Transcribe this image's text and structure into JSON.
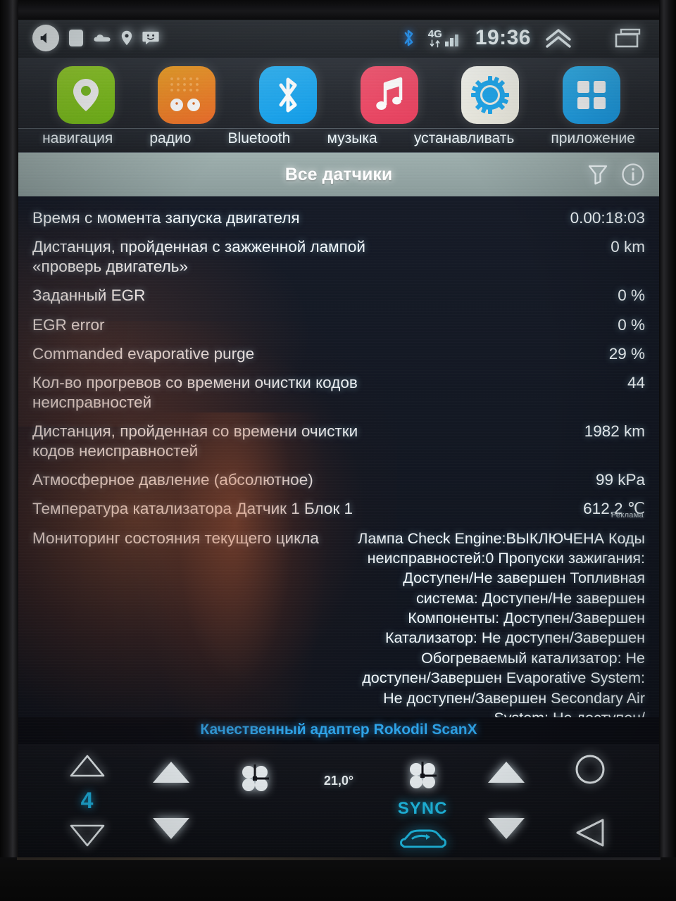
{
  "statusbar": {
    "left_icons": [
      "volume-icon",
      "sim-card-icon",
      "cloud-icon",
      "location-pin-icon",
      "message-icon"
    ],
    "bluetooth_icon": "bluetooth-icon",
    "network_label": "4G",
    "signal_icon": "signal-bars-icon",
    "time": "19:36",
    "expand_icon": "chevron-up-icon",
    "recents_icon": "recent-apps-icon"
  },
  "launcher": {
    "apps": [
      {
        "label": "навигация",
        "icon": "location-pin-icon"
      },
      {
        "label": "радио",
        "icon": "radio-icon"
      },
      {
        "label": "Bluetooth",
        "icon": "bluetooth-icon"
      },
      {
        "label": "музыка",
        "icon": "music-note-icon"
      },
      {
        "label": "устанавливать",
        "icon": "gear-icon"
      },
      {
        "label": "приложение",
        "icon": "grid-apps-icon"
      }
    ]
  },
  "obd": {
    "title": "Все датчики",
    "filter_icon": "filter-icon",
    "info_icon": "info-icon",
    "rows": [
      {
        "name": "Время с момента запуска двигателя",
        "value": "0.00:18:03"
      },
      {
        "name": "Дистанция, пройденная с зажженной лампой «проверь двигатель»",
        "value": "0 km"
      },
      {
        "name": "Заданный EGR",
        "value": "0 %"
      },
      {
        "name": "EGR error",
        "value": "0 %"
      },
      {
        "name": "Commanded evaporative purge",
        "value": "29 %"
      },
      {
        "name": "Кол-во прогревов со времени очистки кодов неисправностей",
        "value": "44"
      },
      {
        "name": "Дистанция, пройденная со времени очистки кодов неисправностей",
        "value": "1982 km"
      },
      {
        "name": "Атмосферное давление (абсолютное)",
        "value": "99 kPa"
      },
      {
        "name": "Температура катализатора Датчик 1 Блок 1",
        "value": "612.2 ℃"
      },
      {
        "name": "Мониторинг состояния текущего цикла",
        "value": "Лампа Check Engine:ВЫКЛЮЧЕНА Коды неисправностей:0 Пропуски зажигания: Доступен/Не завершен Топливная система: Доступен/Не завершен Компоненты: Доступен/Завершен Катализатор: Не доступен/Завершен Обогреваемый катализатор: Не доступен/Завершен Evaporative System: Не доступен/Завершен Secondary Air System: Не доступен/"
      }
    ]
  },
  "ad": {
    "label": "Реклама",
    "text": "Качественный адаптер Rokodil ScanX",
    "color": "#2fa8ef"
  },
  "climate": {
    "fan_level": "4",
    "temperature": "21,0°",
    "sync_label": "SYNC",
    "fan_icon": "fan-icon",
    "recirculation_icon": "car-recirculation-icon",
    "home_icon": "home-circle-icon",
    "back_icon": "back-triangle-icon",
    "up_outline_icon": "triangle-up-outline-icon",
    "down_outline_icon": "triangle-down-outline-icon",
    "up_icon": "triangle-up-icon",
    "down_icon": "triangle-down-icon"
  }
}
